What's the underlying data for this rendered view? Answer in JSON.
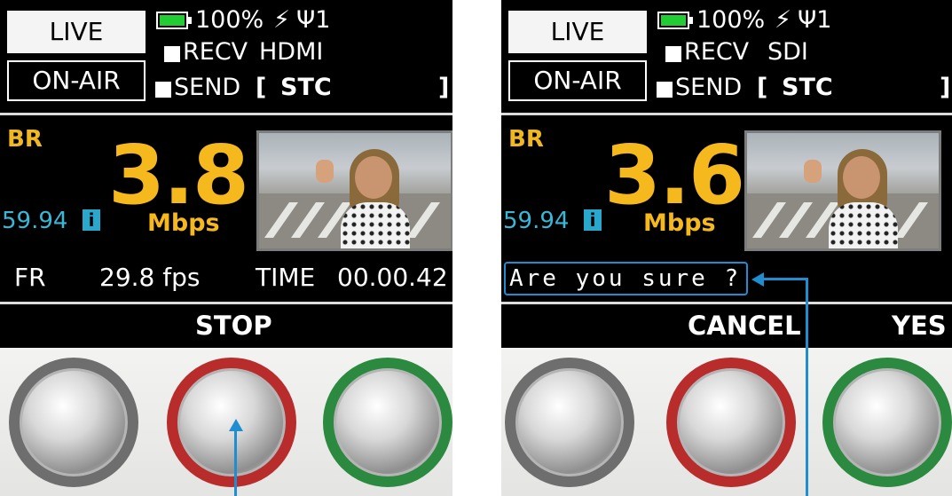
{
  "left": {
    "live": "LIVE",
    "on_air": "ON-AIR",
    "battery": "100%",
    "power_glyph": "⚡",
    "signal": "Ψ1",
    "recv_label": "RECV",
    "recv_value": "HDMI",
    "send_label": "SEND",
    "send_value": "STC",
    "bracket_open": "[",
    "bracket_close": "]",
    "br_label": "BR",
    "bitrate": "3.8",
    "unit": "Mbps",
    "frame_rate": "59.94",
    "fr_label": "FR",
    "fr_value": "29.8 fps",
    "time_label": "TIME",
    "time_value": "00.00.42",
    "softkey_center": "STOP"
  },
  "right": {
    "live": "LIVE",
    "on_air": "ON-AIR",
    "battery": "100%",
    "power_glyph": "⚡",
    "signal": "Ψ1",
    "recv_label": "RECV",
    "recv_value": "SDI",
    "send_label": "SEND",
    "send_value": "STC",
    "bracket_open": "[",
    "bracket_close": "]",
    "br_label": "BR",
    "bitrate": "3.6",
    "unit": "Mbps",
    "frame_rate": "59.94",
    "confirm": "Are you sure ?",
    "softkey_center": "CANCEL",
    "softkey_right": "YES"
  },
  "icons": {
    "info": "i"
  },
  "colors": {
    "bitrate": "#f5b81d",
    "frame_rate": "#39b7d7",
    "battery": "#22cc33",
    "callout": "#1f8ed0",
    "knob_left": "#6e6e6e",
    "knob_center": "#b82c2c",
    "knob_right": "#2c8a40"
  }
}
